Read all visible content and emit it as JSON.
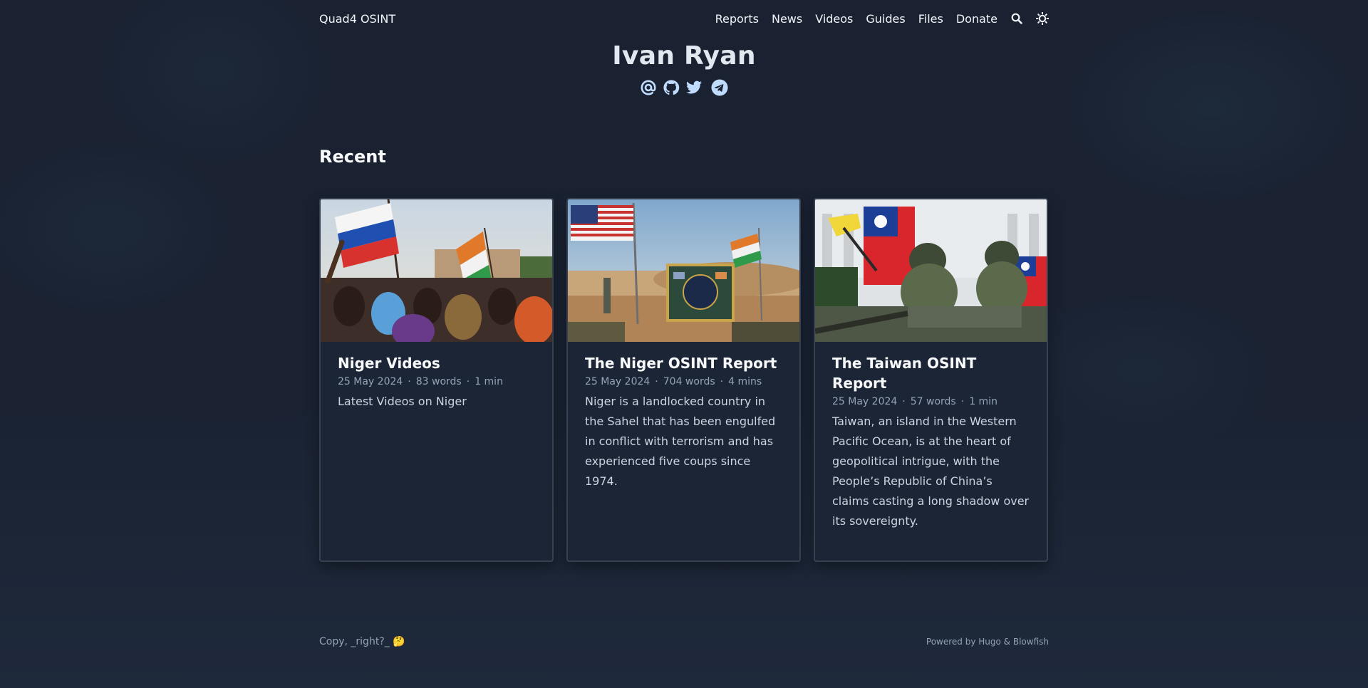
{
  "site": {
    "title": "Quad4 OSINT"
  },
  "nav": {
    "items": [
      "Reports",
      "News",
      "Videos",
      "Guides",
      "Files",
      "Donate"
    ],
    "search_icon": "search-icon",
    "theme_icon": "sun-icon"
  },
  "hero": {
    "name": "Ivan Ryan",
    "socials": [
      "email-icon",
      "github-icon",
      "twitter-icon",
      "telegram-icon"
    ]
  },
  "recent": {
    "heading": "Recent",
    "cards": [
      {
        "title": "Niger Videos",
        "date": "25 May 2024",
        "words": "83 words",
        "read": "1 min",
        "summary": "Latest Videos on Niger"
      },
      {
        "title": "The Niger OSINT Report",
        "date": "25 May 2024",
        "words": "704 words",
        "read": "4 mins",
        "summary": "Niger is a landlocked country in the Sahel that has been engulfed in conflict with terrorism and has experienced five coups since 1974."
      },
      {
        "title": "The Taiwan OSINT Report",
        "date": "25 May 2024",
        "words": "57 words",
        "read": "1 min",
        "summary": "Taiwan, an island in the Western Pacific Ocean, is at the heart of geopolitical intrigue, with the People’s Republic of China’s claims casting a long shadow over its sovereignty."
      }
    ]
  },
  "footer": {
    "copy": "Copy, _right?_ 🤔",
    "powered_prefix": "Powered by ",
    "hugo": "Hugo",
    "amp": " & ",
    "blowfish": "Blowfish"
  },
  "colors": {
    "background": "#1a2232",
    "card_border": "#374151",
    "accent_icon": "#bfdbfe"
  }
}
